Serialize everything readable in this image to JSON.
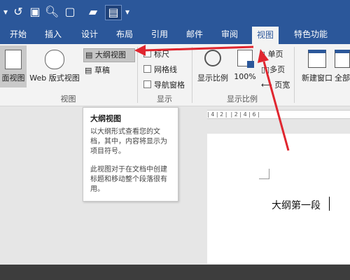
{
  "ribbon_tabs": [
    "开始",
    "插入",
    "设计",
    "布局",
    "引用",
    "邮件",
    "审阅",
    "视图",
    "特色功能"
  ],
  "views_group": {
    "label": "视图",
    "page_view": "面视图",
    "web_view": "Web 版式视图",
    "outline": "大纲视图",
    "draft": "草稿"
  },
  "show_group": {
    "label": "显示",
    "ruler": "标尺",
    "gridlines": "网格线",
    "nav_pane": "导航窗格"
  },
  "zoom_group": {
    "label": "显示比例",
    "zoom": "显示比例",
    "hundred": "100%",
    "one_page": "单页",
    "multi_page": "多页",
    "page_width": "页宽"
  },
  "window_group": {
    "new_window": "新建窗口",
    "arrange_all": "全部"
  },
  "tooltip": {
    "title": "大纲视图",
    "para1": "以大纲形式查看您的文档，其中，内容将显示为项目符号。",
    "para2": "此视图对于在文档中创建标题和移动整个段落很有用。"
  },
  "ruler_text": "| 4 | 2 |  | 2 | 4 | 6 |",
  "document": {
    "text": "大纲第一段"
  },
  "colors": {
    "word_blue": "#2b579a",
    "arrow_red": "#e0262f"
  }
}
